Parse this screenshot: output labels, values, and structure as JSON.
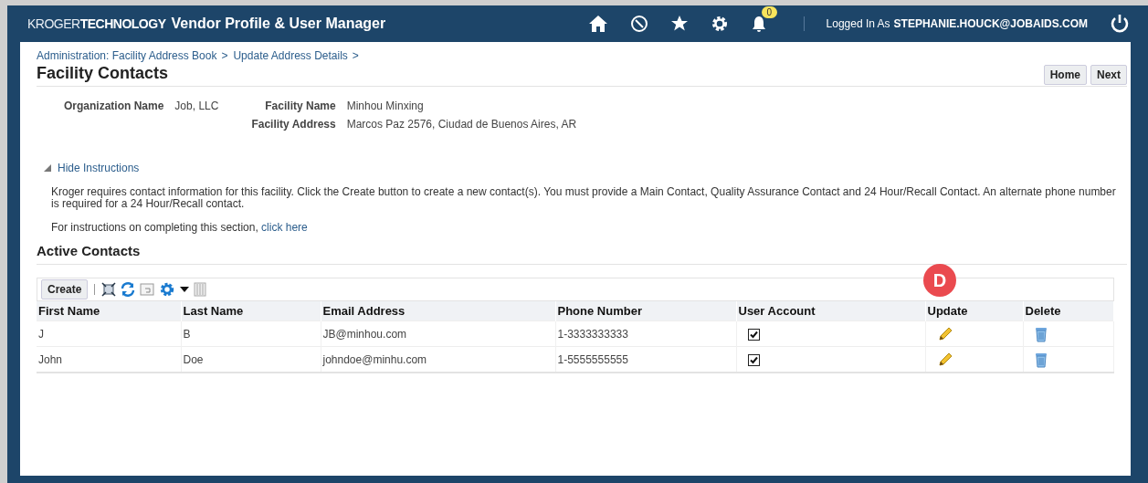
{
  "header": {
    "logo_light": "KROGER",
    "logo_bold": "TECHNOLOGY",
    "title": "Vendor Profile & User Manager",
    "notification_count": "0",
    "logged_in_label": "Logged In As",
    "user": "STEPHANIE.HOUCK@JOBAIDS.COM"
  },
  "breadcrumbs": [
    "Administration: Facility Address Book",
    "Update Address Details"
  ],
  "breadcrumb_separator": ">",
  "page_title": "Facility Contacts",
  "buttons": [
    "Home",
    "Next"
  ],
  "details": [
    {
      "label": "Organization Name",
      "value": "Job, LLC"
    },
    {
      "label": "Facility Name",
      "value": "Minhou Minxing"
    },
    {
      "label": "Facility Address",
      "value": "Marcos Paz 2576, Ciudad de Buenos Aires, AR"
    }
  ],
  "instructions": {
    "toggle": "Hide Instructions",
    "expanded": true,
    "text": "Kroger requires contact information for this facility. Click the Create button to create a new contact(s). You must provide a Main Contact, Quality Assurance Contact and 24 Hour/Recall Contact. An alternate phone number is required for a 24 Hour/Recall contact.",
    "link_prefix": "For instructions on completing this section,",
    "link": "click here"
  },
  "section_title": "Active Contacts",
  "toolbar": {
    "create": "Create"
  },
  "callout": "D",
  "table": {
    "columns": [
      "First Name",
      "Last Name",
      "Email Address",
      "Phone Number",
      "User Account",
      "Update",
      "Delete"
    ],
    "rows": [
      {
        "first": "J",
        "last": "B",
        "email": "JB@minhou.com",
        "phone": "1-3333333333",
        "user_account": true
      },
      {
        "first": "John",
        "last": "Doe",
        "email": "johndoe@minhu.com",
        "phone": "1-5555555555",
        "user_account": true
      }
    ]
  }
}
